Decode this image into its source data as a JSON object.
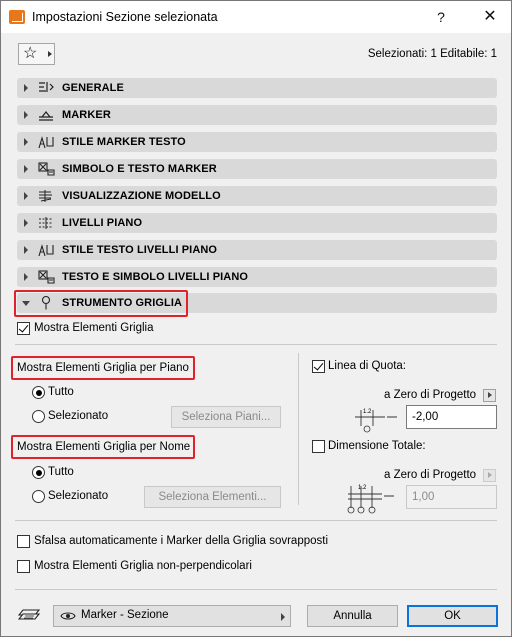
{
  "window": {
    "title": "Impostazioni Sezione selezionata",
    "help_label": "?",
    "close_label": "✕"
  },
  "toolbar": {
    "favorites_icon": "star-icon",
    "selection_info": "Selezionati: 1 Editabile: 1"
  },
  "panels": [
    {
      "label": "GENERALE",
      "icon": "general-settings-icon",
      "expanded": false
    },
    {
      "label": "MARKER",
      "icon": "marker-icon",
      "expanded": false
    },
    {
      "label": "STILE MARKER TESTO",
      "icon": "marker-text-style-icon",
      "expanded": false
    },
    {
      "label": "SIMBOLO E TESTO MARKER",
      "icon": "marker-symbol-text-icon",
      "expanded": false
    },
    {
      "label": "VISUALIZZAZIONE MODELLO",
      "icon": "model-display-icon",
      "expanded": false
    },
    {
      "label": "LIVELLI PIANO",
      "icon": "story-levels-icon",
      "expanded": false
    },
    {
      "label": "STILE TESTO LIVELLI PIANO",
      "icon": "story-level-text-style-icon",
      "expanded": false
    },
    {
      "label": "TESTO E SIMBOLO LIVELLI PIANO",
      "icon": "story-level-text-symbol-icon",
      "expanded": false
    },
    {
      "label": "STRUMENTO GRIGLIA",
      "icon": "grid-tool-icon",
      "expanded": true
    }
  ],
  "grid_tool": {
    "show_grid_elements": {
      "label": "Mostra Elementi Griglia",
      "checked": true
    },
    "by_story": {
      "heading": "Mostra Elementi Griglia per Piano",
      "option_all": "Tutto",
      "option_selected": "Selezionato",
      "selected_value": "Tutto",
      "select_button": "Seleziona Piani..."
    },
    "by_name": {
      "heading": "Mostra Elementi Griglia per Nome",
      "option_all": "Tutto",
      "option_selected": "Selezionato",
      "selected_value": "Tutto",
      "select_button": "Seleziona Elementi..."
    },
    "dimension_line": {
      "label": "Linea di Quota:",
      "checked": true,
      "reference": "a Zero di Progetto",
      "value": "-2,00",
      "diagram_label": "1.2"
    },
    "total_dimension": {
      "label": "Dimensione Totale:",
      "checked": false,
      "reference": "a Zero di Progetto",
      "value": "1,00",
      "diagram_label": "1.2"
    },
    "stagger_markers": {
      "label": "Sfalsa automaticamente i Marker della Griglia sovrapposti",
      "checked": false
    },
    "show_non_perpendicular": {
      "label": "Mostra Elementi Griglia non-perpendicolari",
      "checked": false
    }
  },
  "footer": {
    "layer_icon": "layer-icon",
    "view_dropdown": "Marker - Sezione",
    "cancel_label": "Annulla",
    "ok_label": "OK"
  },
  "colors": {
    "highlight": "#e0232b",
    "panel_bg": "#d9d9d9",
    "primary_border": "#0a74da"
  }
}
